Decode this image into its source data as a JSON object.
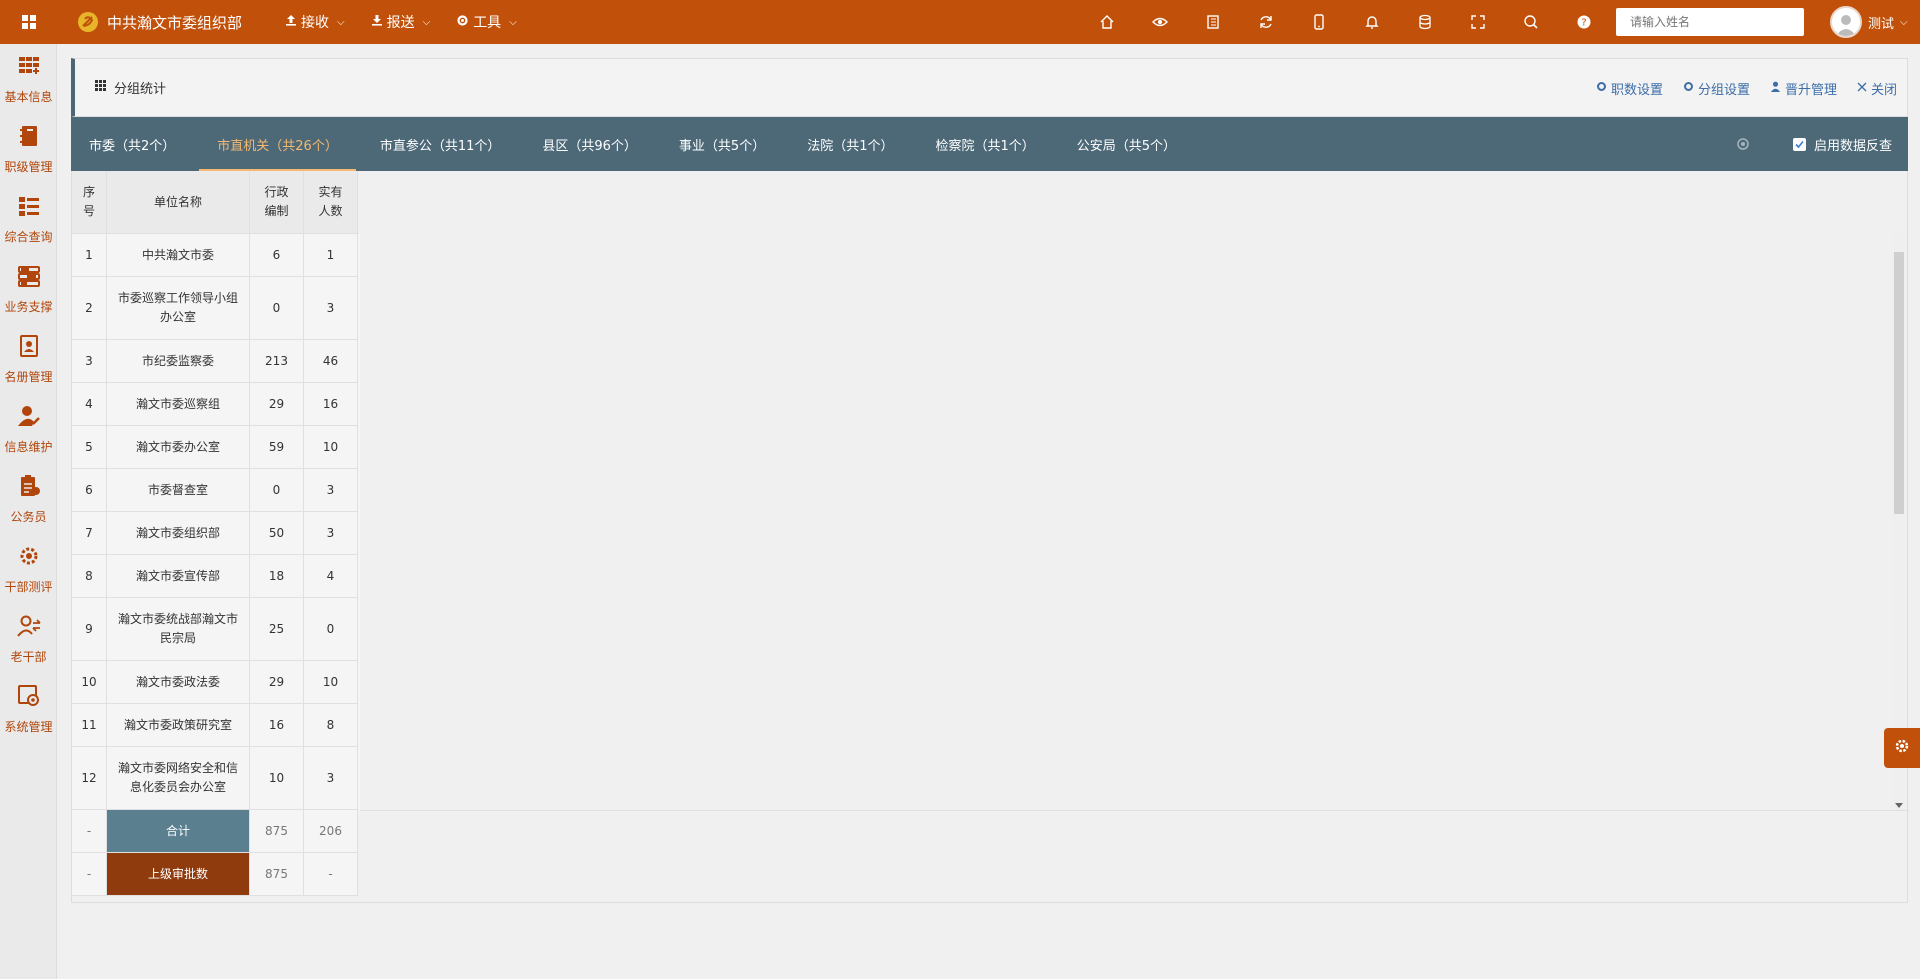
{
  "topbar": {
    "title": "中共瀚文市委组织部",
    "menus": [
      {
        "label": "接收",
        "icon": "upload-icon"
      },
      {
        "label": "报送",
        "icon": "download-icon"
      },
      {
        "label": "工具",
        "icon": "gear-icon"
      }
    ],
    "icons": [
      "home-icon",
      "eye-icon",
      "book-icon",
      "refresh-icon",
      "mobile-icon",
      "bell-icon",
      "database-icon",
      "fullscreen-icon",
      "search-icon",
      "help-icon"
    ],
    "search_placeholder": "请输入姓名",
    "user_name": "测试"
  },
  "sidebar": {
    "items": [
      {
        "label": "基本信息",
        "icon": "grid-icon"
      },
      {
        "label": "职级管理",
        "icon": "notebook-icon"
      },
      {
        "label": "综合查询",
        "icon": "list-icon"
      },
      {
        "label": "业务支撑",
        "icon": "sliders-icon"
      },
      {
        "label": "名册管理",
        "icon": "contact-book-icon"
      },
      {
        "label": "信息维护",
        "icon": "user-edit-icon"
      },
      {
        "label": "公务员",
        "icon": "clipboard-icon"
      },
      {
        "label": "干部测评",
        "icon": "settings-circle-icon"
      },
      {
        "label": "老干部",
        "icon": "user-swap-icon"
      },
      {
        "label": "系统管理",
        "icon": "system-settings-icon"
      }
    ]
  },
  "panel": {
    "title": "分组统计",
    "actions": [
      {
        "label": "职数设置",
        "icon": "gear-icon"
      },
      {
        "label": "分组设置",
        "icon": "gear-icon"
      },
      {
        "label": "晋升管理",
        "icon": "user-icon"
      },
      {
        "label": "关闭",
        "icon": "close-icon"
      }
    ]
  },
  "tabs": [
    {
      "label": "市委（共2个）",
      "active": false
    },
    {
      "label": "市直机关（共26个）",
      "active": true
    },
    {
      "label": "市直参公（共11个）",
      "active": false
    },
    {
      "label": "县区（共96个）",
      "active": false
    },
    {
      "label": "事业（共5个）",
      "active": false
    },
    {
      "label": "法院（共1个）",
      "active": false
    },
    {
      "label": "检察院（共1个）",
      "active": false
    },
    {
      "label": "公安局（共5个）",
      "active": false
    }
  ],
  "data_check": {
    "label": "启用数据反查",
    "checked": true
  },
  "table": {
    "headers": {
      "no": "序\n号",
      "name": "单位名称",
      "admin": "行政\n编制",
      "actual": "实有\n人数"
    },
    "rows": [
      {
        "no": "1",
        "name": "中共瀚文市委",
        "admin": "6",
        "actual": "1"
      },
      {
        "no": "2",
        "name": "市委巡察工作领导小组办公室",
        "admin": "0",
        "actual": "3"
      },
      {
        "no": "3",
        "name": "市纪委监察委",
        "admin": "213",
        "actual": "46"
      },
      {
        "no": "4",
        "name": "瀚文市委巡察组",
        "admin": "29",
        "actual": "16"
      },
      {
        "no": "5",
        "name": "瀚文市委办公室",
        "admin": "59",
        "actual": "10"
      },
      {
        "no": "6",
        "name": "市委督查室",
        "admin": "0",
        "actual": "3"
      },
      {
        "no": "7",
        "name": "瀚文市委组织部",
        "admin": "50",
        "actual": "3"
      },
      {
        "no": "8",
        "name": "瀚文市委宣传部",
        "admin": "18",
        "actual": "4"
      },
      {
        "no": "9",
        "name": "瀚文市委统战部瀚文市民宗局",
        "admin": "25",
        "actual": "0"
      },
      {
        "no": "10",
        "name": "瀚文市委政法委",
        "admin": "29",
        "actual": "10"
      },
      {
        "no": "11",
        "name": "瀚文市委政策研究室",
        "admin": "16",
        "actual": "8"
      },
      {
        "no": "12",
        "name": "瀚文市委网络安全和信息化委员会办公室",
        "admin": "10",
        "actual": "3"
      }
    ],
    "footer": [
      {
        "no": "-",
        "name": "合计",
        "admin": "875",
        "actual": "206"
      },
      {
        "no": "-",
        "name": "上级审批数",
        "admin": "875",
        "actual": "-"
      }
    ]
  },
  "colors": {
    "primary": "#c1510a",
    "tabs_bg": "#4d6978",
    "active_tab": "#f5b971",
    "link": "#3c6ea8",
    "sum_bg": "#5a8090",
    "approve_bg": "#8f3b0e"
  }
}
